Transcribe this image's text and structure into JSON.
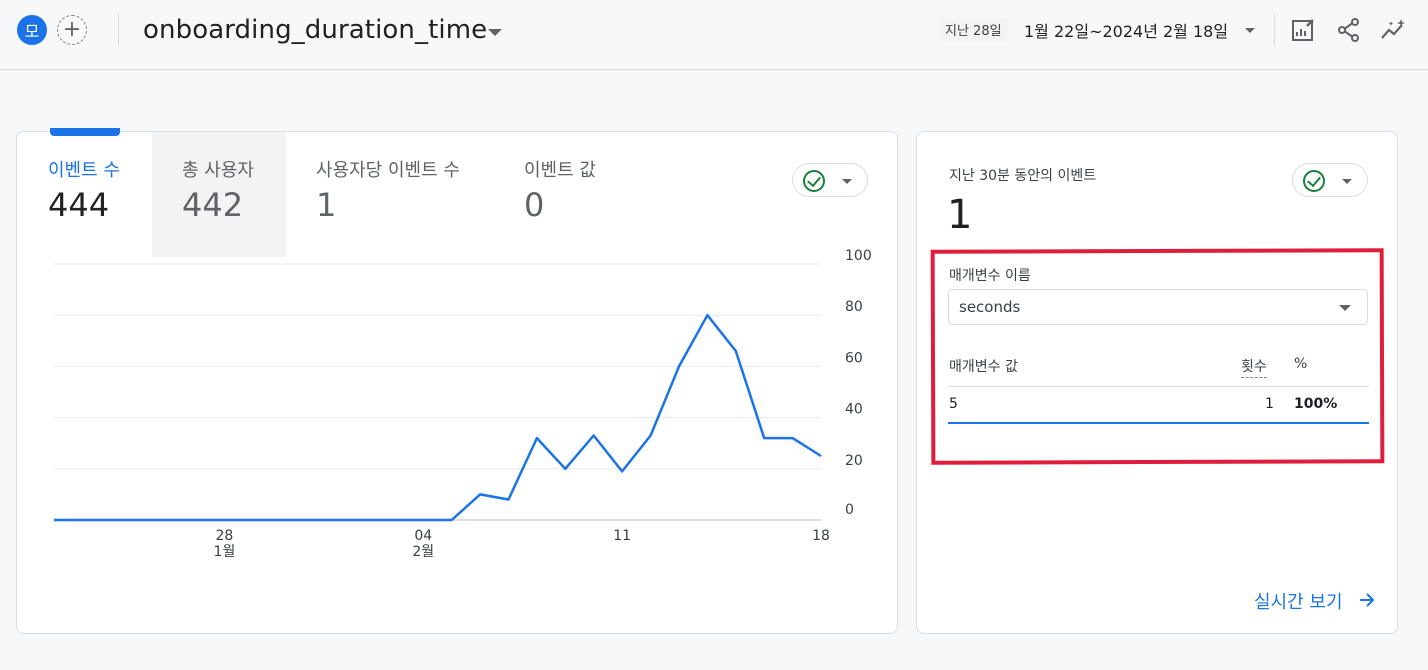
{
  "header": {
    "avatar_letter": "모",
    "add_symbol": "+",
    "title": "onboarding_duration_time",
    "date_chip": "지난 28일",
    "date_range": "1월 22일~2024년 2월 18일",
    "icons": [
      "edit-chart-icon",
      "share-icon",
      "insights-icon"
    ]
  },
  "metrics": [
    {
      "label": "이벤트 수",
      "value": "444",
      "active": true
    },
    {
      "label": "총 사용자",
      "value": "442",
      "selected": true
    },
    {
      "label": "사용자당 이벤트 수",
      "value": "1"
    },
    {
      "label": "이벤트 값",
      "value": "0"
    }
  ],
  "chart_data": {
    "type": "line",
    "title": "",
    "xlabel": "",
    "ylabel": "",
    "x_tick_labels": [
      {
        "day": "28",
        "month": "1월"
      },
      {
        "day": "04",
        "month": "2월"
      },
      {
        "day": "11",
        "month": ""
      },
      {
        "day": "18",
        "month": ""
      }
    ],
    "y_tick_labels": [
      "100",
      "80",
      "60",
      "40",
      "20",
      "0"
    ],
    "ylim": [
      0,
      100
    ],
    "series": [
      {
        "color": "#1a73e8",
        "values": [
          0,
          0,
          0,
          0,
          0,
          0,
          0,
          0,
          0,
          0,
          0,
          0,
          0,
          0,
          0,
          10,
          8,
          32,
          20,
          33,
          19,
          33,
          60,
          80,
          66,
          32,
          32,
          25
        ]
      }
    ],
    "grid": true
  },
  "realtime": {
    "title": "지난 30분 동안의 이벤트",
    "value": "1",
    "param_label": "매개변수 이름",
    "param_selected": "seconds",
    "columns": [
      "매개변수 값",
      "횟수",
      "%"
    ],
    "rows": [
      {
        "value": "5",
        "count": "1",
        "percent": "100%"
      }
    ],
    "link_label": "실시간 보기"
  },
  "colors": {
    "accent": "#1a73e8",
    "highlight": "#e01e3c",
    "check": "#188038"
  }
}
